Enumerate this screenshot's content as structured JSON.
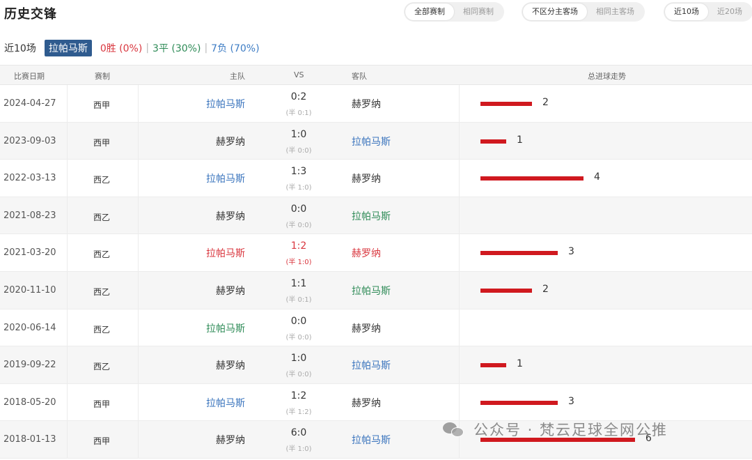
{
  "title": "历史交锋",
  "filters": {
    "competition": [
      "全部赛制",
      "相同赛制"
    ],
    "venue": [
      "不区分主客场",
      "相同主客场"
    ],
    "range": [
      "近10场",
      "近20场"
    ]
  },
  "summary": {
    "label": "近10场",
    "team": "拉帕马斯",
    "win": "0胜 (0%)",
    "draw": "3平 (30%)",
    "loss": "7负 (70%)",
    "sep": "|"
  },
  "columns": {
    "date": "比赛日期",
    "competition": "赛制",
    "home": "主队",
    "vs": "VS",
    "away": "客队",
    "trend": "总进球走势"
  },
  "matches": [
    {
      "date": "2024-04-27",
      "comp": "西甲",
      "home": "拉帕马斯",
      "score": "0:2",
      "half": "(半 0:1)",
      "away": "赫罗纳",
      "goals": 2,
      "goals_label": "2"
    },
    {
      "date": "2023-09-03",
      "comp": "西甲",
      "home": "赫罗纳",
      "score": "1:0",
      "half": "(半 0:0)",
      "away": "拉帕马斯",
      "goals": 1,
      "goals_label": "1"
    },
    {
      "date": "2022-03-13",
      "comp": "西乙",
      "home": "拉帕马斯",
      "score": "1:3",
      "half": "(半 1:0)",
      "away": "赫罗纳",
      "goals": 4,
      "goals_label": "4"
    },
    {
      "date": "2021-08-23",
      "comp": "西乙",
      "home": "赫罗纳",
      "score": "0:0",
      "half": "(半 0:0)",
      "away": "拉帕马斯",
      "goals": 0,
      "goals_label": ""
    },
    {
      "date": "2021-03-20",
      "comp": "西乙",
      "home": "拉帕马斯",
      "score": "1:2",
      "half": "(半 1:0)",
      "away": "赫罗纳",
      "goals": 3,
      "goals_label": "3"
    },
    {
      "date": "2020-11-10",
      "comp": "西乙",
      "home": "赫罗纳",
      "score": "1:1",
      "half": "(半 0:1)",
      "away": "拉帕马斯",
      "goals": 2,
      "goals_label": "2"
    },
    {
      "date": "2020-06-14",
      "comp": "西乙",
      "home": "拉帕马斯",
      "score": "0:0",
      "half": "(半 0:0)",
      "away": "赫罗纳",
      "goals": 0,
      "goals_label": ""
    },
    {
      "date": "2019-09-22",
      "comp": "西乙",
      "home": "赫罗纳",
      "score": "1:0",
      "half": "(半 0:0)",
      "away": "拉帕马斯",
      "goals": 1,
      "goals_label": "1"
    },
    {
      "date": "2018-05-20",
      "comp": "西甲",
      "home": "拉帕马斯",
      "score": "1:2",
      "half": "(半 1:2)",
      "away": "赫罗纳",
      "goals": 3,
      "goals_label": "3"
    },
    {
      "date": "2018-01-13",
      "comp": "西甲",
      "home": "赫罗纳",
      "score": "6:0",
      "half": "(半 1:0)",
      "away": "拉帕马斯",
      "goals": 6,
      "goals_label": "6"
    }
  ],
  "row_colors": [
    {
      "home": "#3a74bd",
      "away": "#333333",
      "score": "#333333",
      "half": "#aaaaaa"
    },
    {
      "home": "#333333",
      "away": "#3a74bd",
      "score": "#333333",
      "half": "#aaaaaa"
    },
    {
      "home": "#3a74bd",
      "away": "#333333",
      "score": "#333333",
      "half": "#aaaaaa"
    },
    {
      "home": "#333333",
      "away": "#2e8b57",
      "score": "#333333",
      "half": "#aaaaaa"
    },
    {
      "home": "#d9363e",
      "away": "#d9363e",
      "score": "#d9363e",
      "half": "#d9363e"
    },
    {
      "home": "#333333",
      "away": "#2e8b57",
      "score": "#333333",
      "half": "#aaaaaa"
    },
    {
      "home": "#2e8b57",
      "away": "#333333",
      "score": "#333333",
      "half": "#aaaaaa"
    },
    {
      "home": "#333333",
      "away": "#3a74bd",
      "score": "#333333",
      "half": "#aaaaaa"
    },
    {
      "home": "#3a74bd",
      "away": "#333333",
      "score": "#333333",
      "half": "#aaaaaa"
    },
    {
      "home": "#333333",
      "away": "#3a74bd",
      "score": "#333333",
      "half": "#aaaaaa"
    }
  ],
  "accent_colors": {
    "bar": "#d0191f",
    "badge": "#2f5b8f",
    "win": "#d9363e",
    "draw": "#2e8b57",
    "loss": "#3d7cc4"
  },
  "watermark": {
    "text": "公众号 · 梵云足球全网公推",
    "icon": "wechat-icon"
  }
}
